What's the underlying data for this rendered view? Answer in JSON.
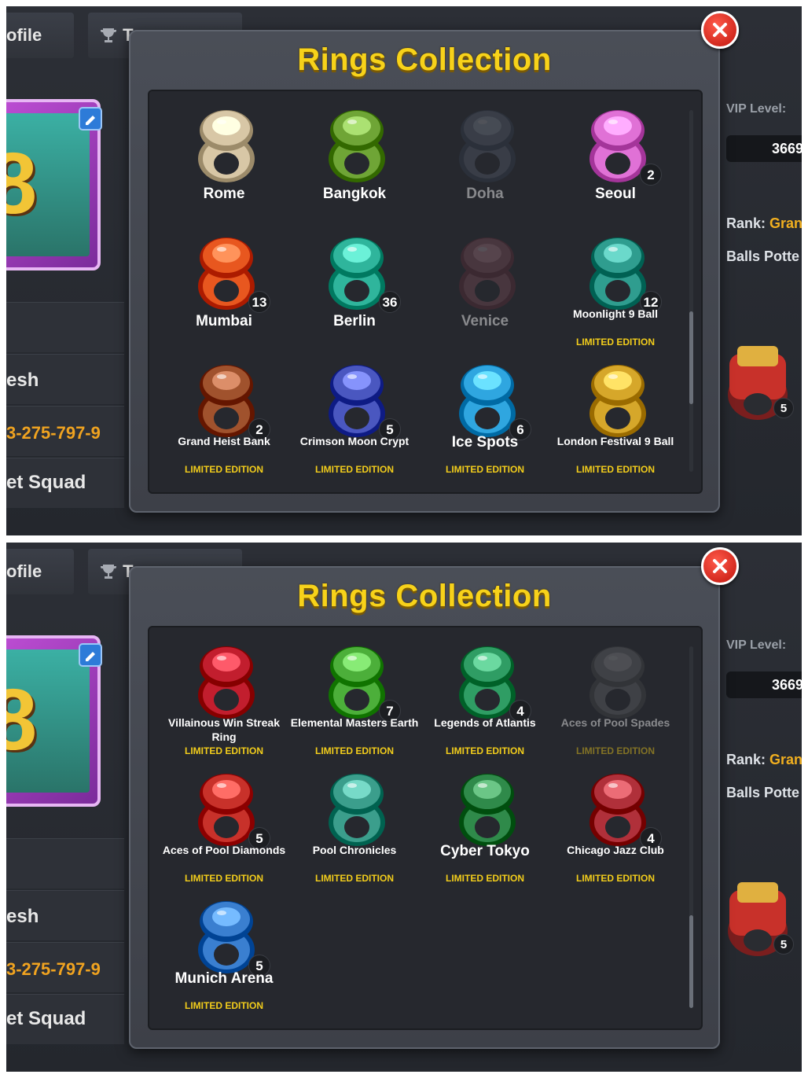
{
  "background": {
    "tab_profile": "ofile",
    "tab_tournaments": "T",
    "left_rows": [
      "esh",
      "3-275-797-9",
      "et Squad"
    ],
    "vip_label": "VIP Level:",
    "vip_value": "3669",
    "rank_label": "Rank:",
    "rank_value": "Gran",
    "balls_label": "Balls Potte",
    "ring_count": "5"
  },
  "modal": {
    "title": "Rings Collection"
  },
  "screens": [
    {
      "rings": [
        {
          "name": "Rome",
          "count": "",
          "edition": "",
          "locked": false,
          "color": "#d8c7a6"
        },
        {
          "name": "Bangkok",
          "count": "",
          "edition": "",
          "locked": false,
          "color": "#6fa536"
        },
        {
          "name": "Doha",
          "count": "",
          "edition": "",
          "locked": true,
          "color": "#7c8aa0"
        },
        {
          "name": "Seoul",
          "count": "2",
          "edition": "",
          "locked": false,
          "color": "#e071d6"
        },
        {
          "name": "Mumbai",
          "count": "13",
          "edition": "",
          "locked": false,
          "color": "#e8571f"
        },
        {
          "name": "Berlin",
          "count": "36",
          "edition": "",
          "locked": false,
          "color": "#2fb59c"
        },
        {
          "name": "Venice",
          "count": "",
          "edition": "",
          "locked": true,
          "color": "#c26a7a"
        },
        {
          "name": "Moonlight 9 Ball",
          "count": "12",
          "edition": "LIMITED EDITION",
          "locked": false,
          "color": "#2f9d8f"
        },
        {
          "name": "Grand Heist Bank",
          "count": "2",
          "edition": "LIMITED EDITION",
          "locked": false,
          "color": "#a0522d"
        },
        {
          "name": "Crimson Moon Crypt",
          "count": "5",
          "edition": "LIMITED EDITION",
          "locked": false,
          "color": "#4a57c0"
        },
        {
          "name": "Ice Spots",
          "count": "6",
          "edition": "LIMITED EDITION",
          "locked": false,
          "color": "#2fa6e0"
        },
        {
          "name": "London Festival 9 Ball",
          "count": "",
          "edition": "LIMITED EDITION",
          "locked": false,
          "color": "#d6a72a"
        }
      ],
      "scroll_position": 0.55
    },
    {
      "rings": [
        {
          "name": "Villainous Win Streak Ring",
          "count": "",
          "edition": "LIMITED EDITION",
          "locked": false,
          "color": "#c21e2e"
        },
        {
          "name": "Elemental Masters Earth",
          "count": "7",
          "edition": "LIMITED EDITION",
          "locked": false,
          "color": "#4caf3a"
        },
        {
          "name": "Legends of Atlantis",
          "count": "4",
          "edition": "LIMITED EDITION",
          "locked": false,
          "color": "#2f9d64"
        },
        {
          "name": "Aces of Pool Spades",
          "count": "",
          "edition": "LIMITED EDITION",
          "locked": true,
          "color": "#9a9a9a"
        },
        {
          "name": "Aces of Pool Diamonds",
          "count": "5",
          "edition": "LIMITED EDITION",
          "locked": false,
          "color": "#c8312a"
        },
        {
          "name": "Pool Chronicles",
          "count": "",
          "edition": "LIMITED EDITION",
          "locked": false,
          "color": "#3b9e8c"
        },
        {
          "name": "Cyber Tokyo",
          "count": "",
          "edition": "LIMITED EDITION",
          "locked": false,
          "color": "#2f8a4a"
        },
        {
          "name": "Chicago Jazz Club",
          "count": "4",
          "edition": "LIMITED EDITION",
          "locked": false,
          "color": "#b0303a"
        },
        {
          "name": "Munich Arena",
          "count": "5",
          "edition": "LIMITED EDITION",
          "locked": false,
          "color": "#3a7fd0"
        }
      ],
      "scroll_position": 1.0
    }
  ],
  "icons": {
    "close": "close-icon",
    "trophy": "trophy-icon",
    "edit": "pencil-icon"
  }
}
